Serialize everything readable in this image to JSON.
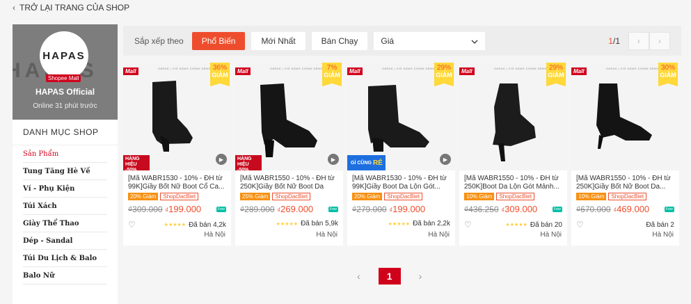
{
  "back": {
    "label": "TRỞ LẠI TRANG CỦA SHOP"
  },
  "shop": {
    "bg_text": "HAPAS",
    "logo_text": "HAPAS",
    "mall_badge": "Shopee Mall",
    "name": "HAPAS Official",
    "online": "Online 31 phút trước"
  },
  "sidebar": {
    "heading": "DANH MỤC SHOP",
    "items": [
      {
        "label": "Sản Phẩm"
      },
      {
        "label": "Tung Tăng Hè Về"
      },
      {
        "label": "Ví - Phụ Kiện"
      },
      {
        "label": "Túi Xách"
      },
      {
        "label": "Giày Thể Thao"
      },
      {
        "label": "Dép - Sandal"
      },
      {
        "label": "Túi Du Lịch & Balo"
      },
      {
        "label": "Balo Nữ"
      }
    ]
  },
  "sort": {
    "label": "Sắp xếp theo",
    "popular": "Phổ Biến",
    "newest": "Mới Nhất",
    "bestseller": "Bán Chạy",
    "price": "Giá",
    "page_current": "1",
    "page_total": "/1"
  },
  "products": [
    {
      "discount": "36%",
      "off": "GIẢM",
      "title": "[Mã WABR1530 - 10% - ĐH từ 99K]Giầy Bốt Nữ Boot Cổ Ca...",
      "tag1": "20% Giảm",
      "tag2": "ShopDacBiet",
      "old_price": "₫309.000",
      "currency": "₫",
      "price": "199.000",
      "sold": "Đã bán 4,2k",
      "location": "Hà Nội",
      "ribbon": "HÀNG HIỆU -50%"
    },
    {
      "discount": "7%",
      "off": "GIẢM",
      "title": "[Mã WABR1550 - 10% - ĐH từ 250K]Giầy Bốt Nữ Boot Da Mi...",
      "tag1": "25% Giảm",
      "tag2": "ShopDacBiet",
      "old_price": "₫289.000",
      "currency": "₫",
      "price": "269.000",
      "sold": "Đã bán 5,9k",
      "location": "Hà Nội",
      "ribbon": "HÀNG HIỆU -50%"
    },
    {
      "discount": "29%",
      "off": "GIẢM",
      "title": "[Mã WABR1530 - 10% - ĐH từ 99K]Giầy Boot Da Lộn Gót...",
      "tag1": "20% Giảm",
      "tag2": "ShopDacBiet",
      "old_price": "₫279.000",
      "currency": "₫",
      "price": "199.000",
      "sold": "Đã bán 2,2k",
      "location": "Hà Nội",
      "ribbon2_a": "GÌ CŨNG",
      "ribbon2_b": "RẺ"
    },
    {
      "discount": "29%",
      "off": "GIẢM",
      "title": "[Mã WABR1550 - 10% - ĐH từ 250K]Boot Da Lộn Gót Mảnh...",
      "tag1": "10% Giảm",
      "tag2": "ShopDacBiet",
      "old_price": "₫436.250",
      "currency": "₫",
      "price": "309.000",
      "sold": "Đã bán 20",
      "location": "Hà Nội"
    },
    {
      "discount": "30%",
      "off": "GIẢM",
      "title": "[Mã WABR1550 - 10% - ĐH từ 250K]Giầy Bốt Nữ Boot Da...",
      "tag1": "10% Giảm",
      "tag2": "ShopDacBiet",
      "old_price": "₫670.000",
      "currency": "₫",
      "price": "469.000",
      "sold": "Đã bán 2",
      "location": "Hà Nội"
    }
  ],
  "common": {
    "mall": "Mall",
    "brandline": "HAPAS | CHỈ HÀNG CHÍNH HÃNG",
    "stars": "★★★★★",
    "freeship": "Free"
  },
  "pagination": {
    "page": "1"
  }
}
